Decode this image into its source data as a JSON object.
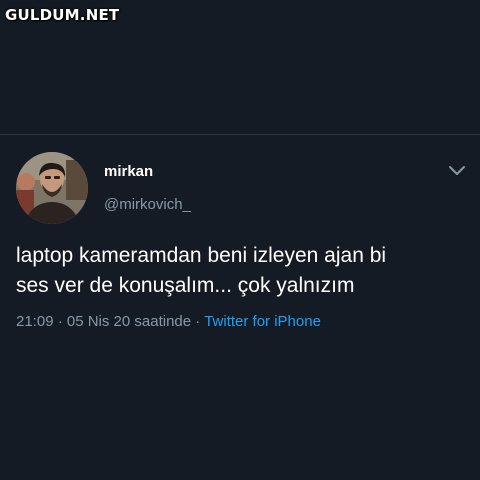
{
  "watermark": "GULDUM.NET",
  "tweet": {
    "display_name": "mirkan",
    "handle": "@mirkovich_",
    "text_line1": "laptop kameramdan beni izleyen ajan bi",
    "text_line2": "ses ver de konuşalım... çok yalnızım",
    "timestamp": "21:09 · 05 Nis 20 saatinde",
    "separator": " · ",
    "source": "Twitter for iPhone",
    "menu_icon": "chevron-down-icon",
    "avatar_icon": "profile-photo"
  },
  "colors": {
    "background": "#151b24",
    "text_primary": "#ffffff",
    "text_secondary": "#8899a6",
    "link": "#1da1f2"
  }
}
